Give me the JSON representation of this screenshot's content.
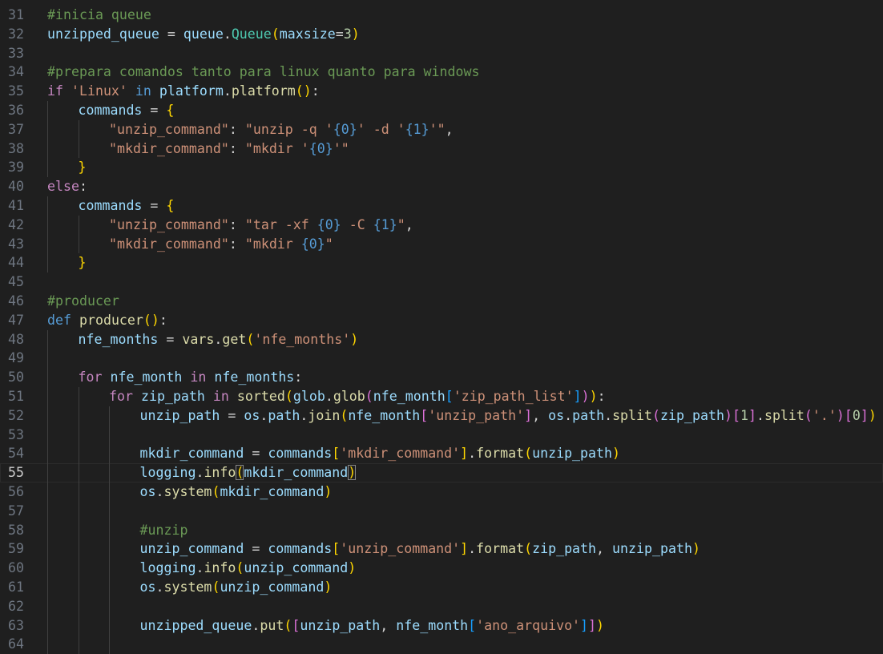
{
  "editor": {
    "active_line": 55,
    "lines": [
      {
        "n": "31",
        "indent": 0,
        "tokens": [
          {
            "t": "#inicia queue",
            "c": "comment"
          }
        ]
      },
      {
        "n": "32",
        "indent": 0,
        "tokens": [
          {
            "t": "unzipped_queue",
            "c": "var"
          },
          {
            "t": " = ",
            "c": "op"
          },
          {
            "t": "queue",
            "c": "var"
          },
          {
            "t": ".",
            "c": "op"
          },
          {
            "t": "Queue",
            "c": "cls"
          },
          {
            "t": "(",
            "c": "b1"
          },
          {
            "t": "maxsize",
            "c": "var"
          },
          {
            "t": "=",
            "c": "op"
          },
          {
            "t": "3",
            "c": "num"
          },
          {
            "t": ")",
            "c": "b1"
          }
        ]
      },
      {
        "n": "33",
        "indent": 0,
        "tokens": []
      },
      {
        "n": "34",
        "indent": 0,
        "tokens": [
          {
            "t": "#prepara comandos tanto para linux quanto para windows",
            "c": "comment"
          }
        ]
      },
      {
        "n": "35",
        "indent": 0,
        "tokens": [
          {
            "t": "if",
            "c": "kw"
          },
          {
            "t": " ",
            "c": "op"
          },
          {
            "t": "'Linux'",
            "c": "str"
          },
          {
            "t": " ",
            "c": "op"
          },
          {
            "t": "in",
            "c": "kwb"
          },
          {
            "t": " ",
            "c": "op"
          },
          {
            "t": "platform",
            "c": "var"
          },
          {
            "t": ".",
            "c": "op"
          },
          {
            "t": "platform",
            "c": "func"
          },
          {
            "t": "()",
            "c": "b1"
          },
          {
            "t": ":",
            "c": "op"
          }
        ]
      },
      {
        "n": "36",
        "indent": 1,
        "tokens": [
          {
            "t": "commands",
            "c": "var"
          },
          {
            "t": " = ",
            "c": "op"
          },
          {
            "t": "{",
            "c": "b1"
          }
        ]
      },
      {
        "n": "37",
        "indent": 2,
        "tokens": [
          {
            "t": "\"unzip_command\"",
            "c": "str"
          },
          {
            "t": ": ",
            "c": "op"
          },
          {
            "t": "\"unzip -q '",
            "c": "str"
          },
          {
            "t": "{0}",
            "c": "fmt"
          },
          {
            "t": "' -d '",
            "c": "str"
          },
          {
            "t": "{1}",
            "c": "fmt"
          },
          {
            "t": "'\"",
            "c": "str"
          },
          {
            "t": ",",
            "c": "op"
          }
        ]
      },
      {
        "n": "38",
        "indent": 2,
        "tokens": [
          {
            "t": "\"mkdir_command\"",
            "c": "str"
          },
          {
            "t": ": ",
            "c": "op"
          },
          {
            "t": "\"mkdir '",
            "c": "str"
          },
          {
            "t": "{0}",
            "c": "fmt"
          },
          {
            "t": "'\"",
            "c": "str"
          }
        ]
      },
      {
        "n": "39",
        "indent": 1,
        "tokens": [
          {
            "t": "}",
            "c": "b1"
          }
        ]
      },
      {
        "n": "40",
        "indent": 0,
        "tokens": [
          {
            "t": "else",
            "c": "kw"
          },
          {
            "t": ":",
            "c": "op"
          }
        ]
      },
      {
        "n": "41",
        "indent": 1,
        "tokens": [
          {
            "t": "commands",
            "c": "var"
          },
          {
            "t": " = ",
            "c": "op"
          },
          {
            "t": "{",
            "c": "b1"
          }
        ]
      },
      {
        "n": "42",
        "indent": 2,
        "tokens": [
          {
            "t": "\"unzip_command\"",
            "c": "str"
          },
          {
            "t": ": ",
            "c": "op"
          },
          {
            "t": "\"tar -xf ",
            "c": "str"
          },
          {
            "t": "{0}",
            "c": "fmt"
          },
          {
            "t": " -C ",
            "c": "str"
          },
          {
            "t": "{1}",
            "c": "fmt"
          },
          {
            "t": "\"",
            "c": "str"
          },
          {
            "t": ",",
            "c": "op"
          }
        ]
      },
      {
        "n": "43",
        "indent": 2,
        "tokens": [
          {
            "t": "\"mkdir_command\"",
            "c": "str"
          },
          {
            "t": ": ",
            "c": "op"
          },
          {
            "t": "\"mkdir ",
            "c": "str"
          },
          {
            "t": "{0}",
            "c": "fmt"
          },
          {
            "t": "\"",
            "c": "str"
          }
        ]
      },
      {
        "n": "44",
        "indent": 1,
        "tokens": [
          {
            "t": "}",
            "c": "b1"
          }
        ]
      },
      {
        "n": "45",
        "indent": 0,
        "tokens": []
      },
      {
        "n": "46",
        "indent": 0,
        "tokens": [
          {
            "t": "#producer",
            "c": "comment"
          }
        ]
      },
      {
        "n": "47",
        "indent": 0,
        "tokens": [
          {
            "t": "def",
            "c": "kwb"
          },
          {
            "t": " ",
            "c": "op"
          },
          {
            "t": "producer",
            "c": "func"
          },
          {
            "t": "()",
            "c": "b1"
          },
          {
            "t": ":",
            "c": "op"
          }
        ]
      },
      {
        "n": "48",
        "indent": 1,
        "tokens": [
          {
            "t": "nfe_months",
            "c": "var"
          },
          {
            "t": " = ",
            "c": "op"
          },
          {
            "t": "vars",
            "c": "func"
          },
          {
            "t": ".",
            "c": "op"
          },
          {
            "t": "get",
            "c": "func"
          },
          {
            "t": "(",
            "c": "b1"
          },
          {
            "t": "'nfe_months'",
            "c": "str"
          },
          {
            "t": ")",
            "c": "b1"
          }
        ]
      },
      {
        "n": "49",
        "indent": 1,
        "tokens": []
      },
      {
        "n": "50",
        "indent": 1,
        "tokens": [
          {
            "t": "for",
            "c": "kw"
          },
          {
            "t": " ",
            "c": "op"
          },
          {
            "t": "nfe_month",
            "c": "var"
          },
          {
            "t": " ",
            "c": "op"
          },
          {
            "t": "in",
            "c": "kw"
          },
          {
            "t": " ",
            "c": "op"
          },
          {
            "t": "nfe_months",
            "c": "var"
          },
          {
            "t": ":",
            "c": "op"
          }
        ]
      },
      {
        "n": "51",
        "indent": 2,
        "tokens": [
          {
            "t": "for",
            "c": "kw"
          },
          {
            "t": " ",
            "c": "op"
          },
          {
            "t": "zip_path",
            "c": "var"
          },
          {
            "t": " ",
            "c": "op"
          },
          {
            "t": "in",
            "c": "kw"
          },
          {
            "t": " ",
            "c": "op"
          },
          {
            "t": "sorted",
            "c": "func"
          },
          {
            "t": "(",
            "c": "b1"
          },
          {
            "t": "glob",
            "c": "var"
          },
          {
            "t": ".",
            "c": "op"
          },
          {
            "t": "glob",
            "c": "func"
          },
          {
            "t": "(",
            "c": "b2"
          },
          {
            "t": "nfe_month",
            "c": "var"
          },
          {
            "t": "[",
            "c": "b3"
          },
          {
            "t": "'zip_path_list'",
            "c": "str"
          },
          {
            "t": "]",
            "c": "b3"
          },
          {
            "t": ")",
            "c": "b2"
          },
          {
            "t": ")",
            "c": "b1"
          },
          {
            "t": ":",
            "c": "op"
          }
        ]
      },
      {
        "n": "52",
        "indent": 3,
        "tokens": [
          {
            "t": "unzip_path",
            "c": "var"
          },
          {
            "t": " = ",
            "c": "op"
          },
          {
            "t": "os",
            "c": "var"
          },
          {
            "t": ".",
            "c": "op"
          },
          {
            "t": "path",
            "c": "var"
          },
          {
            "t": ".",
            "c": "op"
          },
          {
            "t": "join",
            "c": "func"
          },
          {
            "t": "(",
            "c": "b1"
          },
          {
            "t": "nfe_month",
            "c": "var"
          },
          {
            "t": "[",
            "c": "b2"
          },
          {
            "t": "'unzip_path'",
            "c": "str"
          },
          {
            "t": "]",
            "c": "b2"
          },
          {
            "t": ", ",
            "c": "op"
          },
          {
            "t": "os",
            "c": "var"
          },
          {
            "t": ".",
            "c": "op"
          },
          {
            "t": "path",
            "c": "var"
          },
          {
            "t": ".",
            "c": "op"
          },
          {
            "t": "split",
            "c": "func"
          },
          {
            "t": "(",
            "c": "b2"
          },
          {
            "t": "zip_path",
            "c": "var"
          },
          {
            "t": ")",
            "c": "b2"
          },
          {
            "t": "[",
            "c": "b2"
          },
          {
            "t": "1",
            "c": "num"
          },
          {
            "t": "]",
            "c": "b2"
          },
          {
            "t": ".",
            "c": "op"
          },
          {
            "t": "split",
            "c": "func"
          },
          {
            "t": "(",
            "c": "b2"
          },
          {
            "t": "'.'",
            "c": "str"
          },
          {
            "t": ")",
            "c": "b2"
          },
          {
            "t": "[",
            "c": "b2"
          },
          {
            "t": "0",
            "c": "num"
          },
          {
            "t": "]",
            "c": "b2"
          },
          {
            "t": ")",
            "c": "b1"
          }
        ]
      },
      {
        "n": "53",
        "indent": 3,
        "tokens": []
      },
      {
        "n": "54",
        "indent": 3,
        "tokens": [
          {
            "t": "mkdir_command",
            "c": "var"
          },
          {
            "t": " = ",
            "c": "op"
          },
          {
            "t": "commands",
            "c": "var"
          },
          {
            "t": "[",
            "c": "b1"
          },
          {
            "t": "'mkdir_command'",
            "c": "str"
          },
          {
            "t": "]",
            "c": "b1"
          },
          {
            "t": ".",
            "c": "op"
          },
          {
            "t": "format",
            "c": "func"
          },
          {
            "t": "(",
            "c": "b1"
          },
          {
            "t": "unzip_path",
            "c": "var"
          },
          {
            "t": ")",
            "c": "b1"
          }
        ]
      },
      {
        "n": "55",
        "indent": 3,
        "tokens": [
          {
            "t": "logging",
            "c": "var"
          },
          {
            "t": ".",
            "c": "op"
          },
          {
            "t": "info",
            "c": "func"
          },
          {
            "t": "(",
            "c": "b1",
            "m": true
          },
          {
            "t": "mkdir_command",
            "c": "var"
          },
          {
            "t": ")",
            "c": "b1",
            "m": true
          }
        ]
      },
      {
        "n": "56",
        "indent": 3,
        "tokens": [
          {
            "t": "os",
            "c": "var"
          },
          {
            "t": ".",
            "c": "op"
          },
          {
            "t": "system",
            "c": "func"
          },
          {
            "t": "(",
            "c": "b1"
          },
          {
            "t": "mkdir_command",
            "c": "var"
          },
          {
            "t": ")",
            "c": "b1"
          }
        ]
      },
      {
        "n": "57",
        "indent": 3,
        "tokens": []
      },
      {
        "n": "58",
        "indent": 3,
        "tokens": [
          {
            "t": "#unzip",
            "c": "comment"
          }
        ]
      },
      {
        "n": "59",
        "indent": 3,
        "tokens": [
          {
            "t": "unzip_command",
            "c": "var"
          },
          {
            "t": " = ",
            "c": "op"
          },
          {
            "t": "commands",
            "c": "var"
          },
          {
            "t": "[",
            "c": "b1"
          },
          {
            "t": "'unzip_command'",
            "c": "str"
          },
          {
            "t": "]",
            "c": "b1"
          },
          {
            "t": ".",
            "c": "op"
          },
          {
            "t": "format",
            "c": "func"
          },
          {
            "t": "(",
            "c": "b1"
          },
          {
            "t": "zip_path",
            "c": "var"
          },
          {
            "t": ", ",
            "c": "op"
          },
          {
            "t": "unzip_path",
            "c": "var"
          },
          {
            "t": ")",
            "c": "b1"
          }
        ]
      },
      {
        "n": "60",
        "indent": 3,
        "tokens": [
          {
            "t": "logging",
            "c": "var"
          },
          {
            "t": ".",
            "c": "op"
          },
          {
            "t": "info",
            "c": "func"
          },
          {
            "t": "(",
            "c": "b1"
          },
          {
            "t": "unzip_command",
            "c": "var"
          },
          {
            "t": ")",
            "c": "b1"
          }
        ]
      },
      {
        "n": "61",
        "indent": 3,
        "tokens": [
          {
            "t": "os",
            "c": "var"
          },
          {
            "t": ".",
            "c": "op"
          },
          {
            "t": "system",
            "c": "func"
          },
          {
            "t": "(",
            "c": "b1"
          },
          {
            "t": "unzip_command",
            "c": "var"
          },
          {
            "t": ")",
            "c": "b1"
          }
        ]
      },
      {
        "n": "62",
        "indent": 3,
        "tokens": []
      },
      {
        "n": "63",
        "indent": 3,
        "tokens": [
          {
            "t": "unzipped_queue",
            "c": "var"
          },
          {
            "t": ".",
            "c": "op"
          },
          {
            "t": "put",
            "c": "func"
          },
          {
            "t": "(",
            "c": "b1"
          },
          {
            "t": "[",
            "c": "b2"
          },
          {
            "t": "unzip_path",
            "c": "var"
          },
          {
            "t": ", ",
            "c": "op"
          },
          {
            "t": "nfe_month",
            "c": "var"
          },
          {
            "t": "[",
            "c": "b3"
          },
          {
            "t": "'ano_arquivo'",
            "c": "str"
          },
          {
            "t": "]",
            "c": "b3"
          },
          {
            "t": "]",
            "c": "b2"
          },
          {
            "t": ")",
            "c": "b1"
          }
        ]
      },
      {
        "n": "64",
        "indent": 3,
        "tokens": []
      }
    ]
  }
}
